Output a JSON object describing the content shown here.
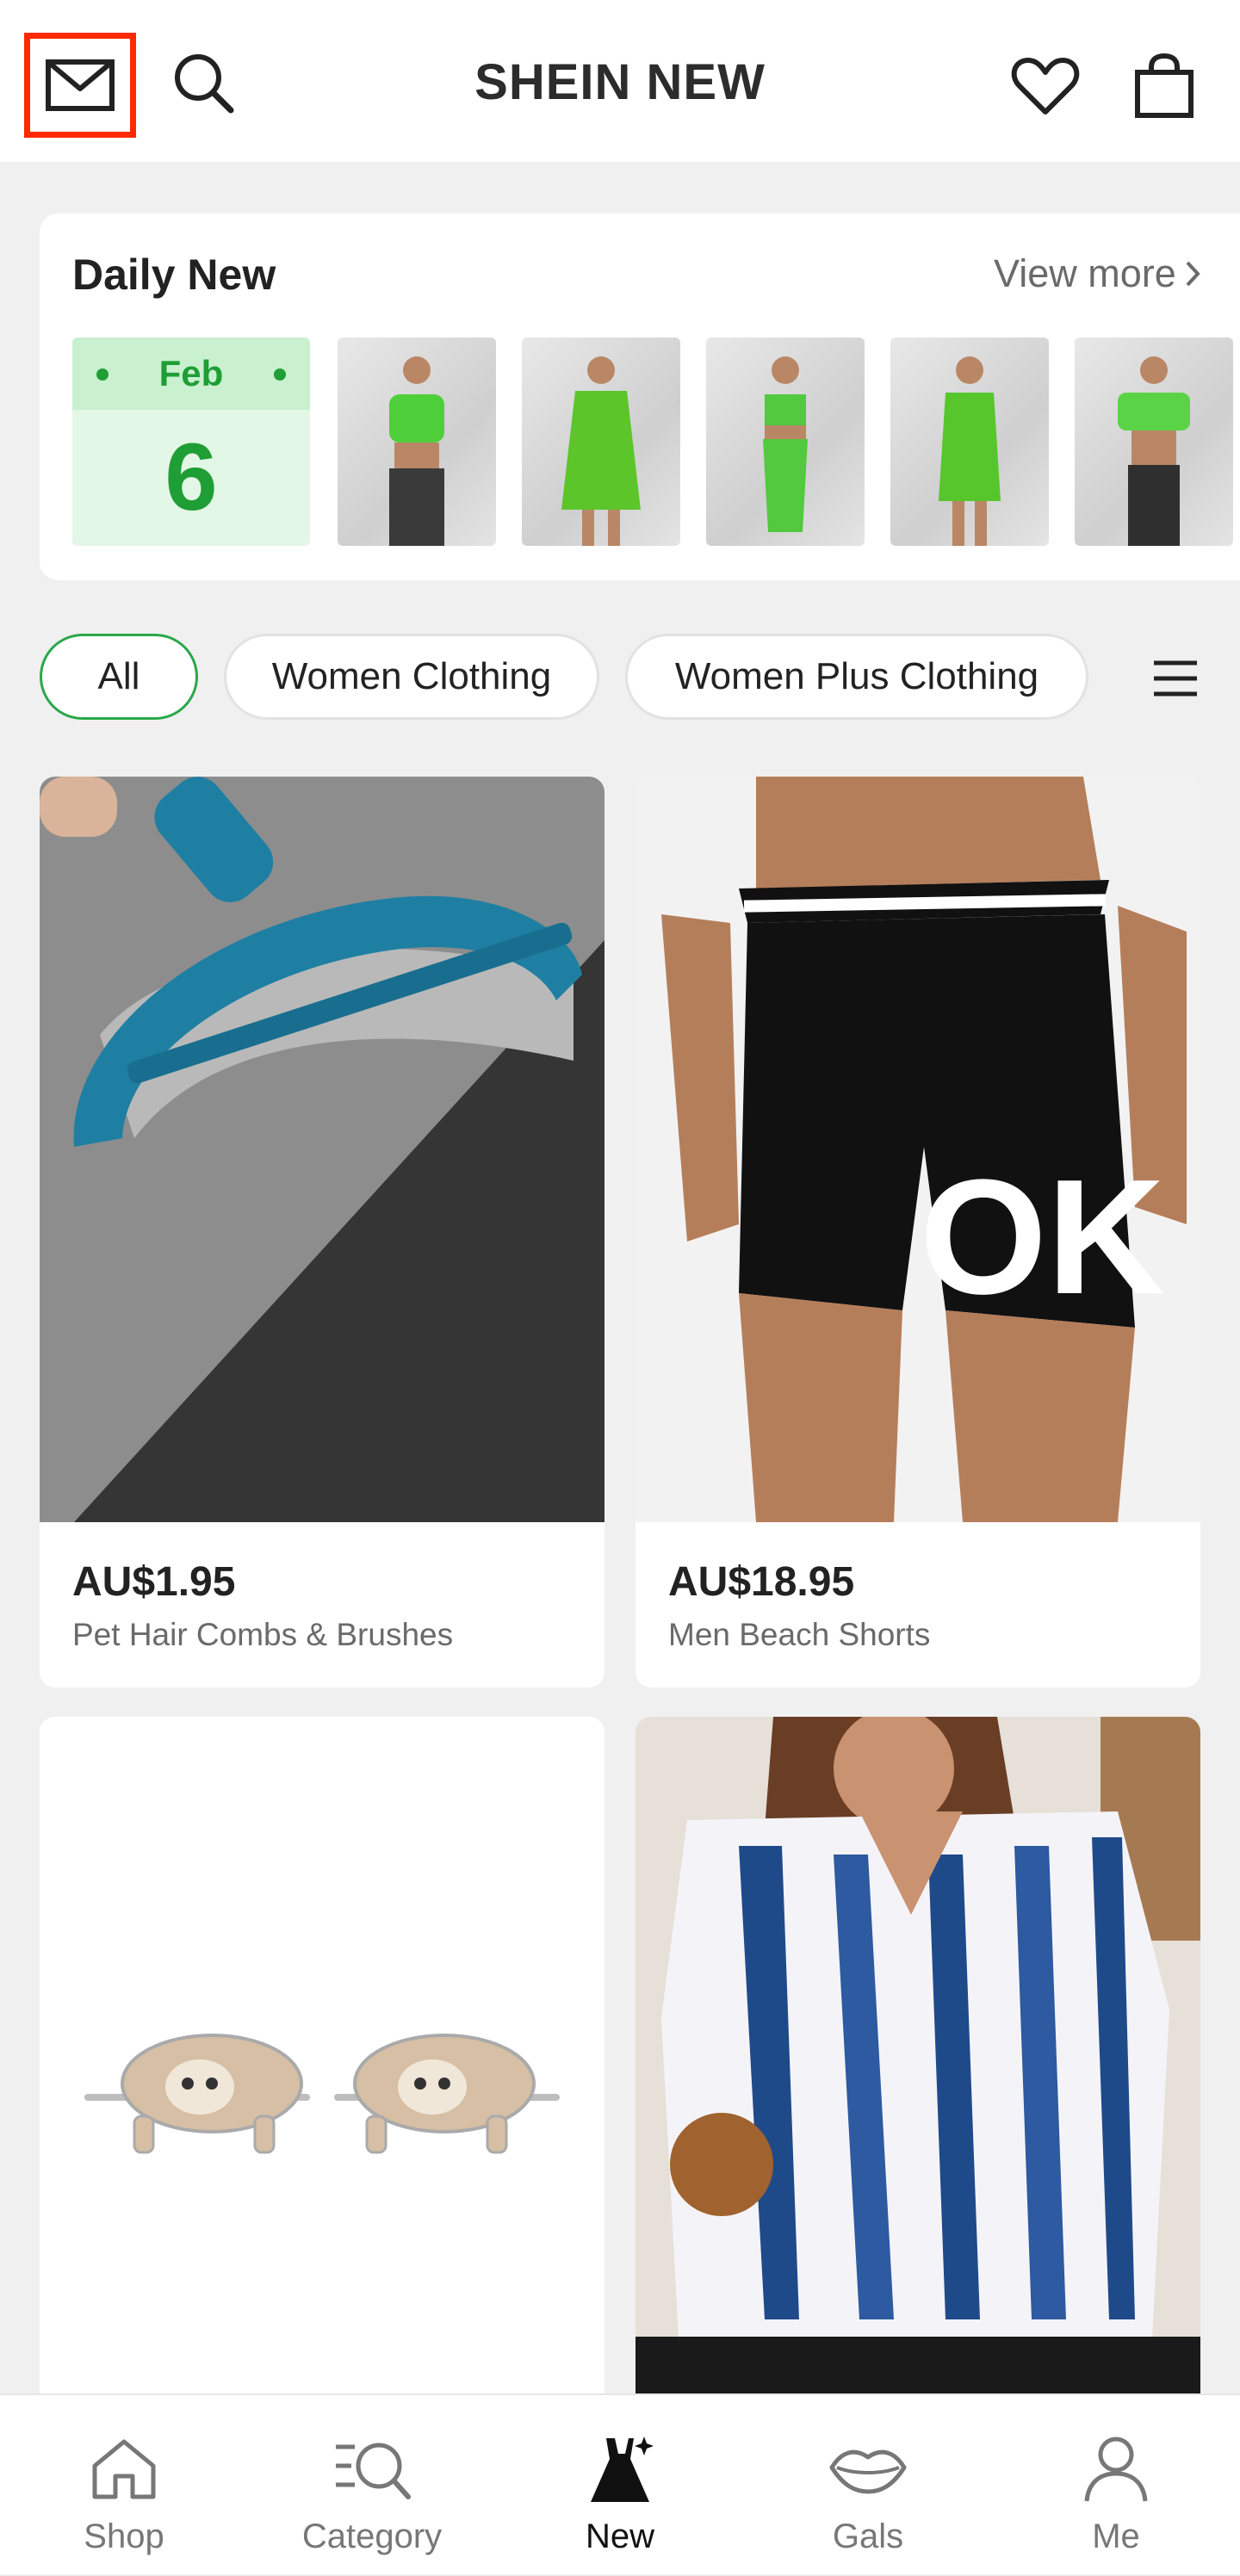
{
  "header": {
    "title": "SHEIN NEW",
    "icons": [
      "mail-icon",
      "search-icon",
      "heart-icon",
      "shopping-bag-icon"
    ]
  },
  "daily_new": {
    "title": "Daily New",
    "view_more": "View more",
    "date": {
      "month": "Feb",
      "day": "6"
    },
    "thumbnails": [
      {
        "outfit_color": "#4fcf3a"
      },
      {
        "outfit_color": "#5cc52a"
      },
      {
        "outfit_color": "#52c93e"
      },
      {
        "outfit_color": "#56c62c"
      },
      {
        "outfit_color": "#5ad446"
      }
    ]
  },
  "tabs": [
    {
      "label": "All",
      "active": true
    },
    {
      "label": "Women Clothing",
      "active": false
    },
    {
      "label": "Women Plus Clothing",
      "active": false
    }
  ],
  "products": [
    {
      "price": "AU$1.95",
      "name": "Pet Hair Combs & Brushes"
    },
    {
      "price": "AU$18.95",
      "name": "Men Beach Shorts"
    },
    {
      "price": "",
      "name": ""
    },
    {
      "price": "",
      "name": ""
    }
  ],
  "shorts_print": "OK",
  "nav": [
    {
      "label": "Shop",
      "icon": "home-icon"
    },
    {
      "label": "Category",
      "icon": "category-search-icon"
    },
    {
      "label": "New",
      "icon": "dress-sparkle-icon",
      "active": true
    },
    {
      "label": "Gals",
      "icon": "lips-icon"
    },
    {
      "label": "Me",
      "icon": "person-icon"
    }
  ],
  "colors": {
    "accent_green": "#2aa84a",
    "date_green": "#1e9e35",
    "highlight_red": "#ff2a00"
  }
}
